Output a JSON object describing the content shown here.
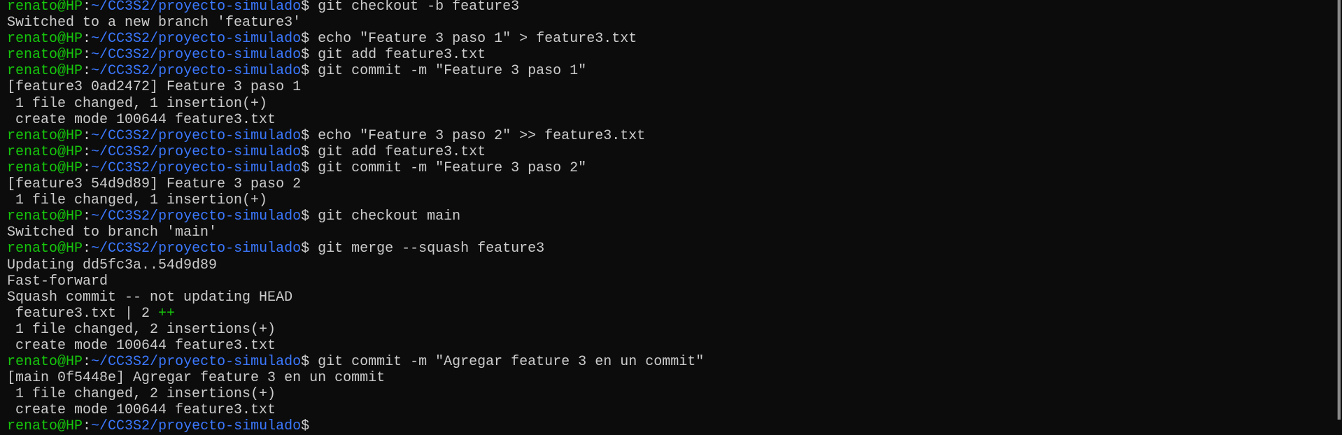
{
  "prompt": {
    "user": "renato@HP",
    "sep": ":",
    "path": "~/CC3S2/proyecto-simulado",
    "symbol": "$ "
  },
  "lines": [
    {
      "type": "cmd",
      "text": "git checkout -b feature3"
    },
    {
      "type": "out",
      "text": "Switched to a new branch 'feature3'"
    },
    {
      "type": "cmd",
      "text": "echo \"Feature 3 paso 1\" > feature3.txt"
    },
    {
      "type": "cmd",
      "text": "git add feature3.txt"
    },
    {
      "type": "cmd",
      "text": "git commit -m \"Feature 3 paso 1\""
    },
    {
      "type": "out",
      "text": "[feature3 0ad2472] Feature 3 paso 1"
    },
    {
      "type": "out",
      "text": " 1 file changed, 1 insertion(+)"
    },
    {
      "type": "out",
      "text": " create mode 100644 feature3.txt"
    },
    {
      "type": "cmd",
      "text": "echo \"Feature 3 paso 2\" >> feature3.txt"
    },
    {
      "type": "cmd",
      "text": "git add feature3.txt"
    },
    {
      "type": "cmd",
      "text": "git commit -m \"Feature 3 paso 2\""
    },
    {
      "type": "out",
      "text": "[feature3 54d9d89] Feature 3 paso 2"
    },
    {
      "type": "out",
      "text": " 1 file changed, 1 insertion(+)"
    },
    {
      "type": "cmd",
      "text": "git checkout main"
    },
    {
      "type": "out",
      "text": "Switched to branch 'main'"
    },
    {
      "type": "cmd",
      "text": "git merge --squash feature3"
    },
    {
      "type": "out",
      "text": "Updating dd5fc3a..54d9d89"
    },
    {
      "type": "out",
      "text": "Fast-forward"
    },
    {
      "type": "out",
      "text": "Squash commit -- not updating HEAD"
    },
    {
      "type": "stat",
      "text": " feature3.txt | 2 ",
      "extra": "++"
    },
    {
      "type": "out",
      "text": " 1 file changed, 2 insertions(+)"
    },
    {
      "type": "out",
      "text": " create mode 100644 feature3.txt"
    },
    {
      "type": "cmd",
      "text": "git commit -m \"Agregar feature 3 en un commit\""
    },
    {
      "type": "out",
      "text": "[main 0f5448e] Agregar feature 3 en un commit"
    },
    {
      "type": "out",
      "text": " 1 file changed, 2 insertions(+)"
    },
    {
      "type": "out",
      "text": " create mode 100644 feature3.txt"
    },
    {
      "type": "cmd",
      "text": ""
    }
  ]
}
